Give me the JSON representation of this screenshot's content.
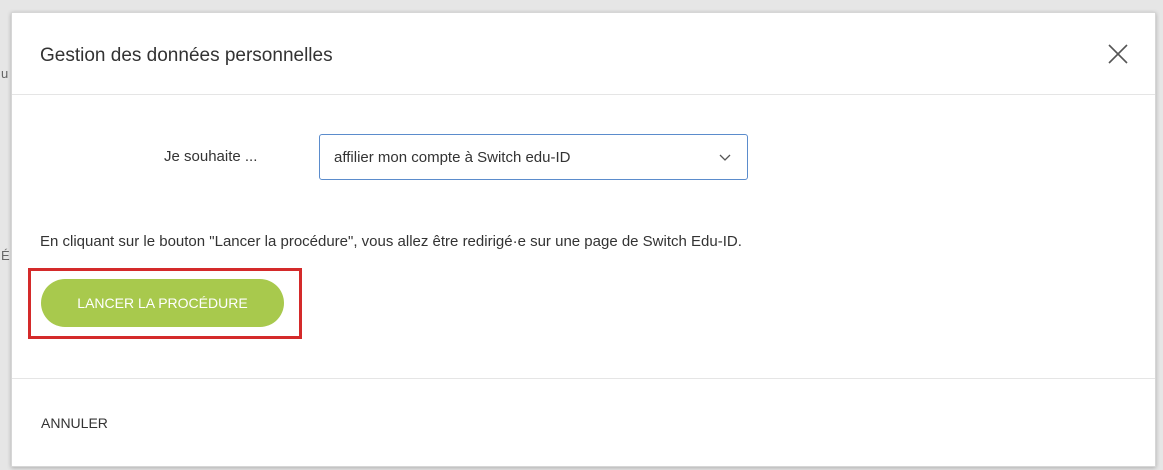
{
  "background": {
    "fragment_1": "u",
    "fragment_2": "É"
  },
  "dialog": {
    "title": "Gestion des données personnelles",
    "close_icon": "close-icon"
  },
  "form": {
    "label": "Je souhaite ...",
    "select": {
      "selected": "affilier mon compte à Switch edu-ID",
      "icon": "chevron-down-icon"
    }
  },
  "info_text": "En cliquant sur le bouton \"Lancer la procédure\", vous allez être redirigé·e sur une page de Switch Edu-ID.",
  "launch_button": {
    "label": "LANCER LA PROCÉDURE"
  },
  "footer": {
    "cancel_label": "ANNULER"
  },
  "colors": {
    "accent_green": "#a8c94d",
    "highlight_red": "#d42a2a",
    "select_border": "#5b8ccc"
  }
}
